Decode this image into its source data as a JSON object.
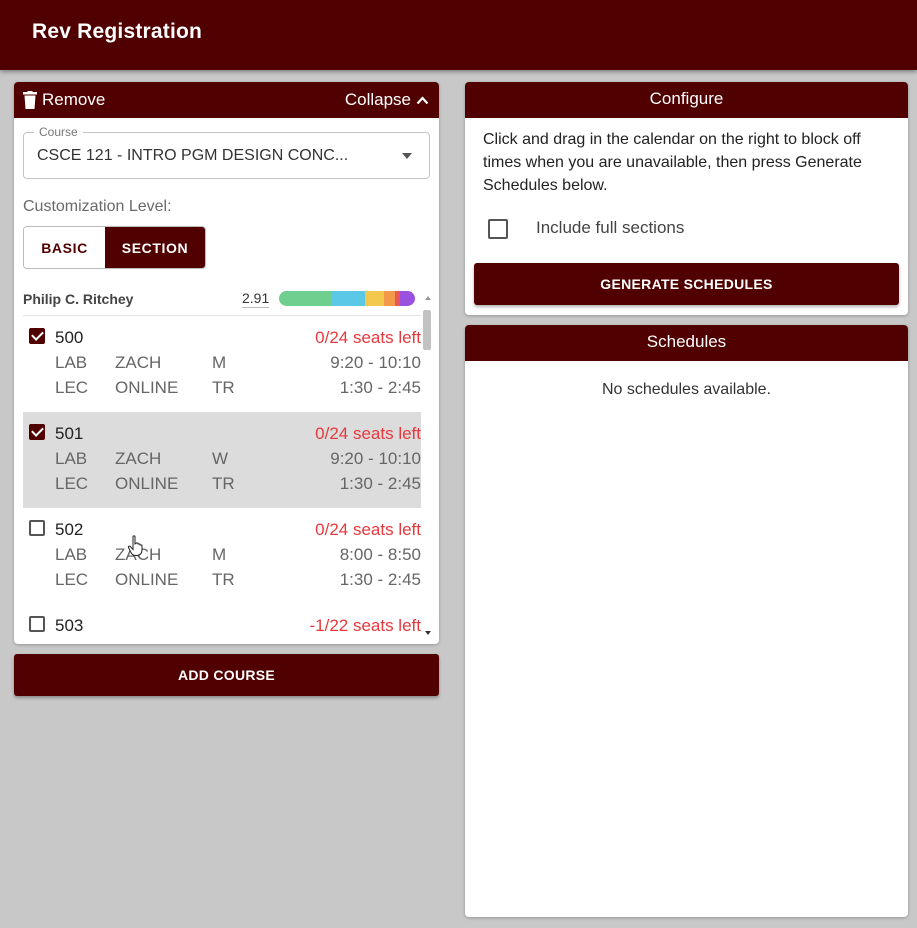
{
  "app": {
    "title": "Rev Registration"
  },
  "course_card": {
    "remove_label": "Remove",
    "collapse_label": "Collapse",
    "course_field_label": "Course",
    "course_value": "CSCE 121 - INTRO PGM DESIGN CONC...",
    "customization_label": "Customization Level:",
    "level_basic": "BASIC",
    "level_section": "SECTION",
    "selected_level": "SECTION",
    "professor": {
      "name": "Philip C. Ritchey",
      "gpa": "2.91",
      "grade_colors": [
        "#6fcf8e",
        "#5bc8e8",
        "#f2c94c",
        "#f2994a",
        "#eb5757",
        "#9b51e0"
      ]
    },
    "sections": [
      {
        "number": "500",
        "checked": true,
        "seats": "0/24 seats left",
        "meetings": [
          {
            "type": "LAB",
            "building": "ZACH",
            "days": "M",
            "time": "9:20 - 10:10"
          },
          {
            "type": "LEC",
            "building": "ONLINE",
            "days": "TR",
            "time": "1:30 - 2:45"
          }
        ]
      },
      {
        "number": "501",
        "checked": true,
        "seats": "0/24 seats left",
        "meetings": [
          {
            "type": "LAB",
            "building": "ZACH",
            "days": "W",
            "time": "9:20 - 10:10"
          },
          {
            "type": "LEC",
            "building": "ONLINE",
            "days": "TR",
            "time": "1:30 - 2:45"
          }
        ]
      },
      {
        "number": "502",
        "checked": false,
        "seats": "0/24 seats left",
        "meetings": [
          {
            "type": "LAB",
            "building": "ZACH",
            "days": "M",
            "time": "8:00 - 8:50"
          },
          {
            "type": "LEC",
            "building": "ONLINE",
            "days": "TR",
            "time": "1:30 - 2:45"
          }
        ]
      },
      {
        "number": "503",
        "checked": false,
        "seats": "-1/22 seats left",
        "meetings": []
      }
    ]
  },
  "add_course_label": "ADD COURSE",
  "configure": {
    "title": "Configure",
    "instructions": "Click and drag in the calendar on the right to block off times when you are unavailable, then press Generate Schedules below.",
    "include_full_label": "Include full sections",
    "include_full_checked": false,
    "generate_label": "GENERATE SCHEDULES"
  },
  "schedules": {
    "title": "Schedules",
    "empty_message": "No schedules available."
  },
  "colors": {
    "brand": "#500000",
    "seats_warning": "#e8383d"
  }
}
